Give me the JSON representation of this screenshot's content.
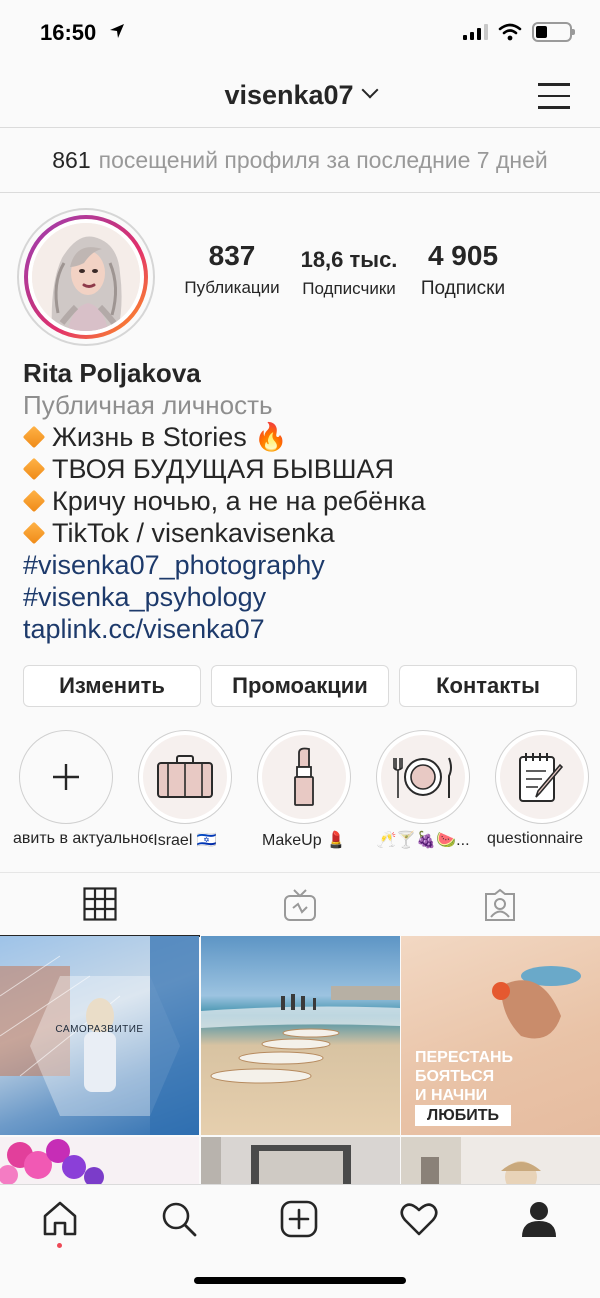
{
  "status": {
    "time": "16:50"
  },
  "header": {
    "username": "visenka07"
  },
  "visits": {
    "count": "861",
    "text": "посещений профиля за последние 7 дней"
  },
  "profile": {
    "posts": {
      "value": "837",
      "label": "Публикации"
    },
    "followers": {
      "value": "18,6 тыс.",
      "label": "Подписчики"
    },
    "following": {
      "value": "4 905",
      "label": "Подписки"
    },
    "name": "Rita Poljakova",
    "category": "Публичная личность",
    "bio_lines": [
      "Жизнь в Stories 🔥",
      "ТВОЯ БУДУЩАЯ БЫВШАЯ",
      "Кричу ночью, а не на ребёнка",
      "TikTok / visenkavisenka"
    ],
    "hashtags": [
      "#visenka07_photography",
      "#visenka_psyhology"
    ],
    "link": "taplink.cc/visenka07"
  },
  "buttons": {
    "edit": "Изменить",
    "promo": "Промоакции",
    "contacts": "Контакты"
  },
  "highlights": [
    {
      "label": "авить в актуальное",
      "icon": "plus-icon"
    },
    {
      "label": "Israel 🇮🇱",
      "icon": "suitcase-icon"
    },
    {
      "label": "MakeUp 💄",
      "icon": "lipstick-icon"
    },
    {
      "label": "🥂🍸🍇🍉...",
      "icon": "plate-icon"
    },
    {
      "label": "questionnaire",
      "icon": "notepad-icon"
    }
  ],
  "posts": {
    "post1_caption": "САМОРАЗВИТИЕ",
    "post3_lines": [
      "ПЕРЕСТАНЬ",
      "БОЯТЬСЯ",
      "И НАЧНИ",
      "ЛЮБИТЬ"
    ]
  },
  "colors": {
    "link": "#1d3a6b",
    "notification_dot": "#ed4956",
    "story_ring": "#c13584"
  }
}
